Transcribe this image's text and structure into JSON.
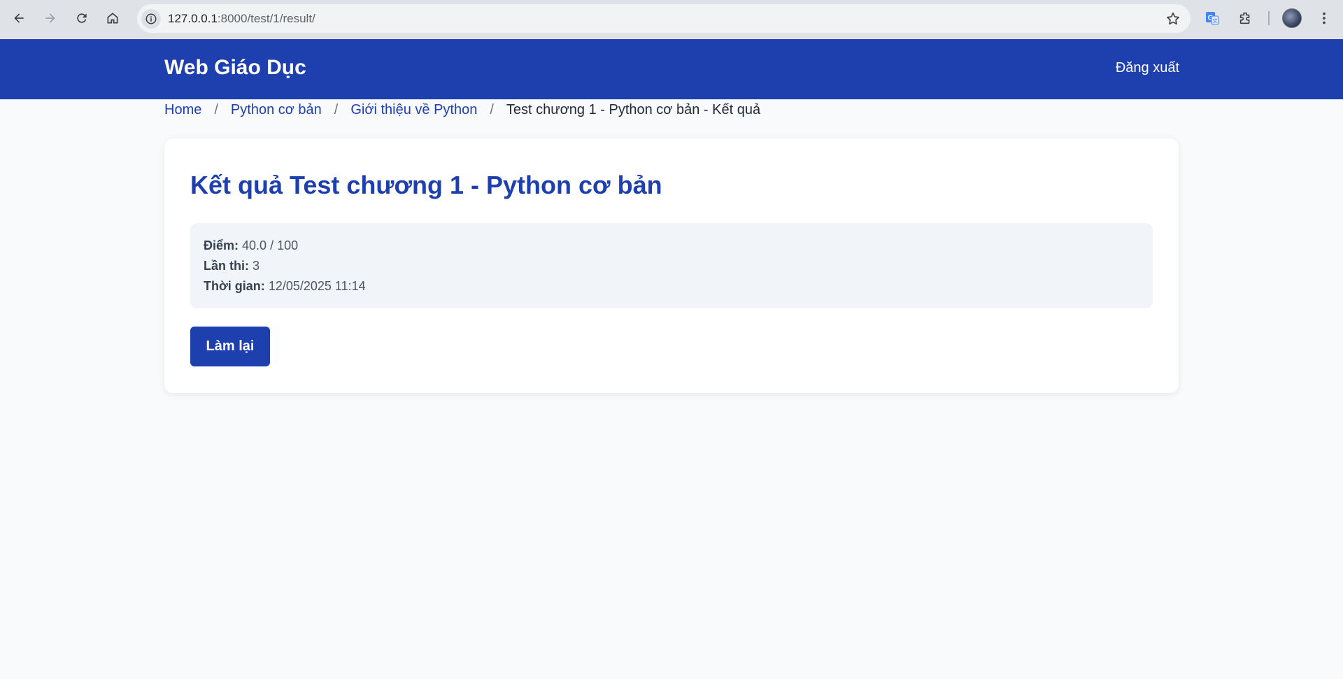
{
  "browser": {
    "url_host": "127.0.0.1",
    "url_path": ":8000/test/1/result/",
    "icons": [
      "back-icon",
      "forward-icon",
      "reload-icon",
      "home-icon",
      "site-info-icon",
      "bookmark-star-icon",
      "translate-icon",
      "extensions-icon",
      "profile-avatar",
      "menu-icon"
    ]
  },
  "header": {
    "brand": "Web Giáo Dục",
    "logout_label": "Đăng xuất",
    "bg_color": "#1e40af"
  },
  "breadcrumb": {
    "items": [
      "Home",
      "Python cơ bản",
      "Giới thiệu về Python"
    ],
    "current": "Test chương 1 - Python cơ bản - Kết quả",
    "separator": "/"
  },
  "result": {
    "title": "Kết quả Test chương 1 - Python cơ bản",
    "score_label": "Điểm:",
    "score_value": "40.0 / 100",
    "attempt_label": "Lần thi:",
    "attempt_value": "3",
    "time_label": "Thời gian:",
    "time_value": "12/05/2025 11:14",
    "retry_label": "Làm lại"
  }
}
